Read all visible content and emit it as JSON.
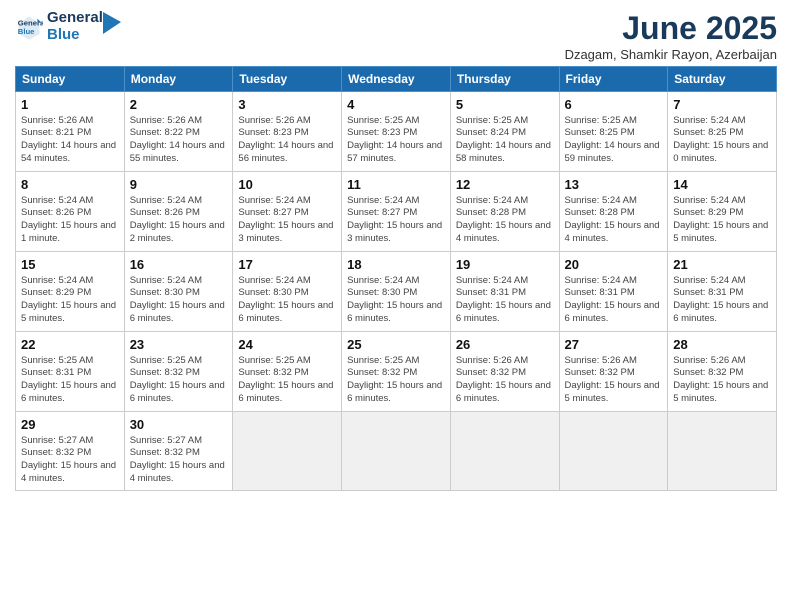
{
  "header": {
    "logo_line1": "General",
    "logo_line2": "Blue",
    "title": "June 2025",
    "subtitle": "Dzagam, Shamkir Rayon, Azerbaijan"
  },
  "calendar": {
    "weekdays": [
      "Sunday",
      "Monday",
      "Tuesday",
      "Wednesday",
      "Thursday",
      "Friday",
      "Saturday"
    ],
    "weeks": [
      [
        null,
        null,
        null,
        null,
        null,
        null,
        null
      ]
    ]
  },
  "days": {
    "1": {
      "num": "1",
      "sunrise": "Sunrise: 5:26 AM",
      "sunset": "Sunset: 8:21 PM",
      "daylight": "Daylight: 14 hours and 54 minutes."
    },
    "2": {
      "num": "2",
      "sunrise": "Sunrise: 5:26 AM",
      "sunset": "Sunset: 8:22 PM",
      "daylight": "Daylight: 14 hours and 55 minutes."
    },
    "3": {
      "num": "3",
      "sunrise": "Sunrise: 5:26 AM",
      "sunset": "Sunset: 8:23 PM",
      "daylight": "Daylight: 14 hours and 56 minutes."
    },
    "4": {
      "num": "4",
      "sunrise": "Sunrise: 5:25 AM",
      "sunset": "Sunset: 8:23 PM",
      "daylight": "Daylight: 14 hours and 57 minutes."
    },
    "5": {
      "num": "5",
      "sunrise": "Sunrise: 5:25 AM",
      "sunset": "Sunset: 8:24 PM",
      "daylight": "Daylight: 14 hours and 58 minutes."
    },
    "6": {
      "num": "6",
      "sunrise": "Sunrise: 5:25 AM",
      "sunset": "Sunset: 8:25 PM",
      "daylight": "Daylight: 14 hours and 59 minutes."
    },
    "7": {
      "num": "7",
      "sunrise": "Sunrise: 5:24 AM",
      "sunset": "Sunset: 8:25 PM",
      "daylight": "Daylight: 15 hours and 0 minutes."
    },
    "8": {
      "num": "8",
      "sunrise": "Sunrise: 5:24 AM",
      "sunset": "Sunset: 8:26 PM",
      "daylight": "Daylight: 15 hours and 1 minute."
    },
    "9": {
      "num": "9",
      "sunrise": "Sunrise: 5:24 AM",
      "sunset": "Sunset: 8:26 PM",
      "daylight": "Daylight: 15 hours and 2 minutes."
    },
    "10": {
      "num": "10",
      "sunrise": "Sunrise: 5:24 AM",
      "sunset": "Sunset: 8:27 PM",
      "daylight": "Daylight: 15 hours and 3 minutes."
    },
    "11": {
      "num": "11",
      "sunrise": "Sunrise: 5:24 AM",
      "sunset": "Sunset: 8:27 PM",
      "daylight": "Daylight: 15 hours and 3 minutes."
    },
    "12": {
      "num": "12",
      "sunrise": "Sunrise: 5:24 AM",
      "sunset": "Sunset: 8:28 PM",
      "daylight": "Daylight: 15 hours and 4 minutes."
    },
    "13": {
      "num": "13",
      "sunrise": "Sunrise: 5:24 AM",
      "sunset": "Sunset: 8:28 PM",
      "daylight": "Daylight: 15 hours and 4 minutes."
    },
    "14": {
      "num": "14",
      "sunrise": "Sunrise: 5:24 AM",
      "sunset": "Sunset: 8:29 PM",
      "daylight": "Daylight: 15 hours and 5 minutes."
    },
    "15": {
      "num": "15",
      "sunrise": "Sunrise: 5:24 AM",
      "sunset": "Sunset: 8:29 PM",
      "daylight": "Daylight: 15 hours and 5 minutes."
    },
    "16": {
      "num": "16",
      "sunrise": "Sunrise: 5:24 AM",
      "sunset": "Sunset: 8:30 PM",
      "daylight": "Daylight: 15 hours and 6 minutes."
    },
    "17": {
      "num": "17",
      "sunrise": "Sunrise: 5:24 AM",
      "sunset": "Sunset: 8:30 PM",
      "daylight": "Daylight: 15 hours and 6 minutes."
    },
    "18": {
      "num": "18",
      "sunrise": "Sunrise: 5:24 AM",
      "sunset": "Sunset: 8:30 PM",
      "daylight": "Daylight: 15 hours and 6 minutes."
    },
    "19": {
      "num": "19",
      "sunrise": "Sunrise: 5:24 AM",
      "sunset": "Sunset: 8:31 PM",
      "daylight": "Daylight: 15 hours and 6 minutes."
    },
    "20": {
      "num": "20",
      "sunrise": "Sunrise: 5:24 AM",
      "sunset": "Sunset: 8:31 PM",
      "daylight": "Daylight: 15 hours and 6 minutes."
    },
    "21": {
      "num": "21",
      "sunrise": "Sunrise: 5:24 AM",
      "sunset": "Sunset: 8:31 PM",
      "daylight": "Daylight: 15 hours and 6 minutes."
    },
    "22": {
      "num": "22",
      "sunrise": "Sunrise: 5:25 AM",
      "sunset": "Sunset: 8:31 PM",
      "daylight": "Daylight: 15 hours and 6 minutes."
    },
    "23": {
      "num": "23",
      "sunrise": "Sunrise: 5:25 AM",
      "sunset": "Sunset: 8:32 PM",
      "daylight": "Daylight: 15 hours and 6 minutes."
    },
    "24": {
      "num": "24",
      "sunrise": "Sunrise: 5:25 AM",
      "sunset": "Sunset: 8:32 PM",
      "daylight": "Daylight: 15 hours and 6 minutes."
    },
    "25": {
      "num": "25",
      "sunrise": "Sunrise: 5:25 AM",
      "sunset": "Sunset: 8:32 PM",
      "daylight": "Daylight: 15 hours and 6 minutes."
    },
    "26": {
      "num": "26",
      "sunrise": "Sunrise: 5:26 AM",
      "sunset": "Sunset: 8:32 PM",
      "daylight": "Daylight: 15 hours and 6 minutes."
    },
    "27": {
      "num": "27",
      "sunrise": "Sunrise: 5:26 AM",
      "sunset": "Sunset: 8:32 PM",
      "daylight": "Daylight: 15 hours and 5 minutes."
    },
    "28": {
      "num": "28",
      "sunrise": "Sunrise: 5:26 AM",
      "sunset": "Sunset: 8:32 PM",
      "daylight": "Daylight: 15 hours and 5 minutes."
    },
    "29": {
      "num": "29",
      "sunrise": "Sunrise: 5:27 AM",
      "sunset": "Sunset: 8:32 PM",
      "daylight": "Daylight: 15 hours and 4 minutes."
    },
    "30": {
      "num": "30",
      "sunrise": "Sunrise: 5:27 AM",
      "sunset": "Sunset: 8:32 PM",
      "daylight": "Daylight: 15 hours and 4 minutes."
    }
  }
}
